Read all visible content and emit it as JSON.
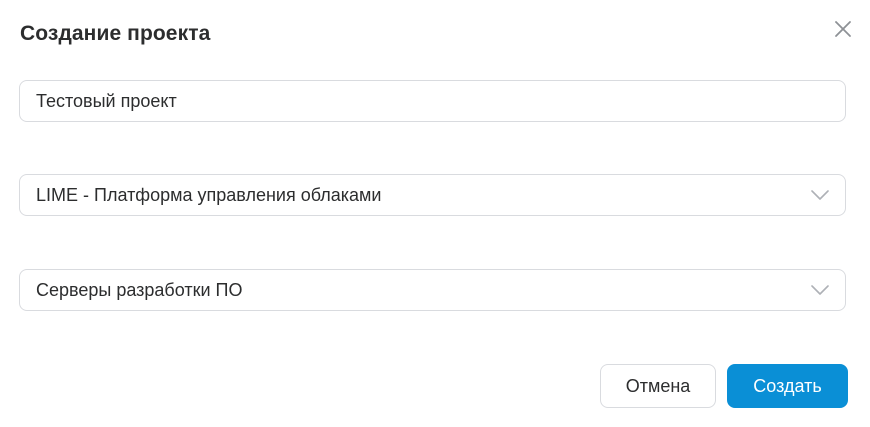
{
  "dialog": {
    "title": "Создание проекта",
    "close_icon": "close-icon"
  },
  "form": {
    "project_name": {
      "value": "Тестовый проект",
      "placeholder": ""
    },
    "platform_select": {
      "selected": "LIME - Платформа управления облаками",
      "icon": "chevron-down-icon"
    },
    "servers_select": {
      "selected": "Серверы разработки ПО",
      "icon": "chevron-down-icon"
    }
  },
  "actions": {
    "cancel_label": "Отмена",
    "create_label": "Создать"
  },
  "colors": {
    "primary": "#0a8fd6",
    "border": "#d9dbdf",
    "text": "#2c2d2e",
    "icon": "#aeb1b6"
  }
}
